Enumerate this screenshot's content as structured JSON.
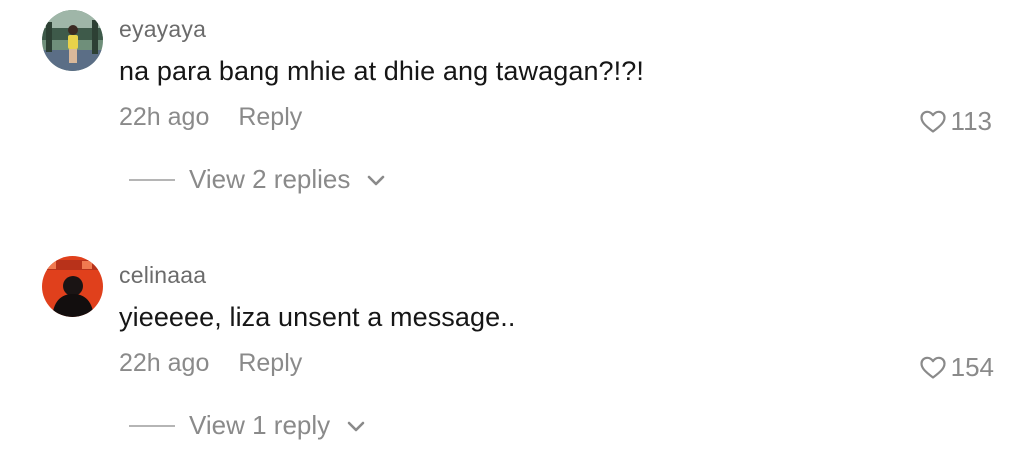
{
  "comments": [
    {
      "username": "eyayaya",
      "text": "na para bang mhie at dhie ang tawagan?!?!",
      "time": "22h ago",
      "reply_label": "Reply",
      "likes": "113",
      "view_replies": "View 2 replies"
    },
    {
      "username": "celinaaa",
      "text": "yieeeee, liza unsent a message..",
      "time": "22h ago",
      "reply_label": "Reply",
      "likes": "154",
      "view_replies": "View 1 reply"
    }
  ],
  "icons": {
    "like": "heart-outline-icon",
    "expand": "chevron-down-icon"
  },
  "colors": {
    "username": "#6b6b6b",
    "text": "#161616",
    "meta": "#8a8a8a",
    "avatar2_bg": "#e0401c"
  }
}
